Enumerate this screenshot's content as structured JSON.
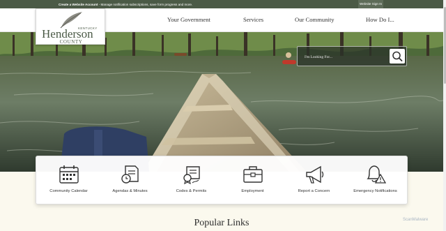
{
  "topbar": {
    "create_account": "Create a Website Account",
    "message": " - Manage notification subscriptions, save form progress and more.",
    "sign_in": "Website Sign In"
  },
  "logo": {
    "state": "KENTUCKY",
    "name": "Henderson",
    "county": "COUNTY"
  },
  "nav": [
    "Your Government",
    "Services",
    "Our Community",
    "How Do I..."
  ],
  "search": {
    "placeholder": "I'm Looking For..."
  },
  "quick_links": [
    {
      "label": "Community Calendar",
      "icon": "calendar-icon"
    },
    {
      "label": "Agendas & Minutes",
      "icon": "document-clock-icon"
    },
    {
      "label": "Codes & Permits",
      "icon": "certificate-icon"
    },
    {
      "label": "Employment",
      "icon": "briefcase-icon"
    },
    {
      "label": "Report a Concern",
      "icon": "megaphone-icon"
    },
    {
      "label": "Emergency Notifications",
      "icon": "alert-bell-icon"
    }
  ],
  "section_title": "Popular Links",
  "watermark": "ScanMalware",
  "colors": {
    "brand_green": "#4b5a46",
    "cream": "#fbf9ee"
  }
}
